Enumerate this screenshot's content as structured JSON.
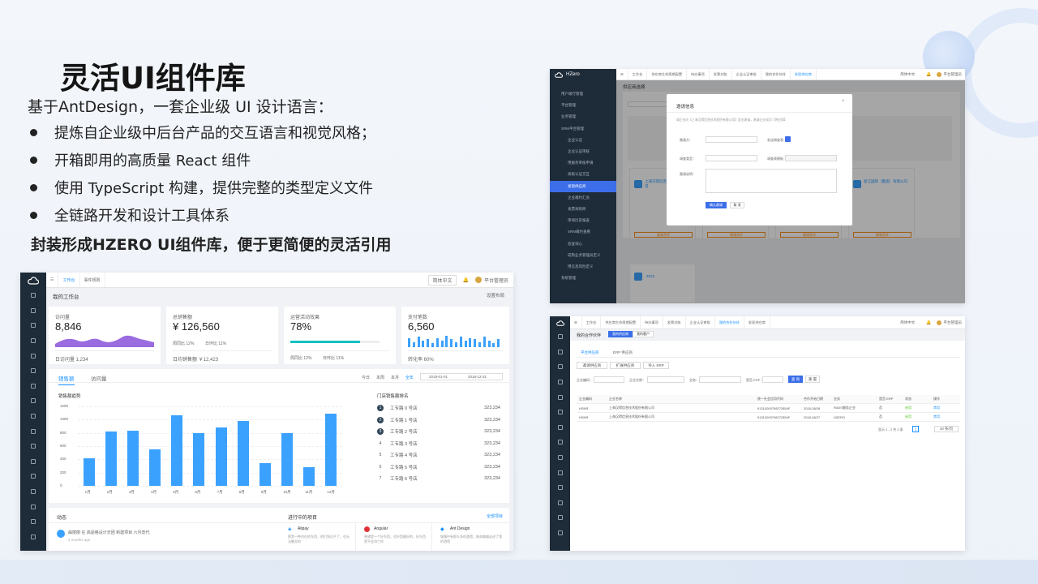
{
  "slide": {
    "title": "灵活UI组件库",
    "intro": "基于AntDesign，一套企业级 UI 设计语言：",
    "bullets": [
      "提炼自企业级中后台产品的交互语言和视觉风格；",
      "开箱即用的高质量 React 组件",
      "使用 TypeScript 构建，提供完整的类型定义文件",
      "全链路开发和设计工具体系"
    ],
    "highlight": "封装形成HZERO UI组件库，便于更简便的灵活引用"
  },
  "dashboard": {
    "tabs": [
      "工作台",
      "事件规则"
    ],
    "lang": "简体中文",
    "user": "平台管理员",
    "page_title": "我的工作台",
    "settings": "设置布局",
    "stats": [
      {
        "label": "访问量",
        "value": "8,846",
        "foot": "日访问量 1,234"
      },
      {
        "label": "总销售额",
        "value": "¥ 126,560",
        "foot1": "周同比 12%",
        "foot2": "日环比 11%",
        "foot3": "日均销售额 ￥12,423"
      },
      {
        "label": "运营活动效果",
        "value": "78%",
        "progress": 0.78,
        "foot1": "周同比 12%",
        "foot2": "日环比 11%"
      },
      {
        "label": "支付笔数",
        "value": "6,560",
        "foot": "转化率 60%"
      }
    ],
    "chart_tabs": [
      "销售额",
      "访问量"
    ],
    "range_tabs": [
      "今日",
      "本周",
      "本月",
      "全年"
    ],
    "date_from": "2018-01-01",
    "date_to": "2018-12-31",
    "chart_title": "销售额趋势",
    "rank_title": "门店销售额排名",
    "chart_data": {
      "type": "bar",
      "title": "销售额趋势",
      "categories": [
        "1月",
        "2月",
        "3月",
        "4月",
        "5月",
        "6月",
        "7月",
        "8月",
        "9月",
        "10月",
        "11月",
        "12月"
      ],
      "values": [
        420,
        820,
        830,
        550,
        1060,
        800,
        880,
        980,
        340,
        800,
        280,
        1090
      ],
      "yticks": [
        "1200",
        "1000",
        "800",
        "600",
        "400",
        "200",
        "0"
      ],
      "ylim": [
        0,
        1200
      ]
    },
    "ranking": [
      {
        "rank": "1",
        "name": "工专路 0 号店",
        "value": "323,234"
      },
      {
        "rank": "2",
        "name": "工专路 1 号店",
        "value": "323,234"
      },
      {
        "rank": "3",
        "name": "工专路 2 号店",
        "value": "323,234"
      },
      {
        "rank": "4",
        "name": "工专路 3 号店",
        "value": "323,234"
      },
      {
        "rank": "5",
        "name": "工专路 4 号店",
        "value": "323,234"
      },
      {
        "rank": "6",
        "name": "工专路 5 号店",
        "value": "323,234"
      },
      {
        "rank": "7",
        "name": "工专路 6 号店",
        "value": "323,234"
      }
    ],
    "activity_title": "动态",
    "activity_text": "曲丽丽 在 高逼格设计天团 新建项目 六月迭代",
    "activity_time": "3 months ago",
    "projects_title": "进行中的项目",
    "projects_all": "全部项目",
    "projects": [
      {
        "name": "Alipay",
        "desc": "那是一种内在的东西，他们到达不了，也无法触及的"
      },
      {
        "name": "Angular",
        "desc": "希望是一个好东西，也许是最好的，好东西是不会消亡的"
      },
      {
        "name": "Ant Design",
        "desc": "城镇中有那么多的酒馆，她却偏偏走进了我的酒馆"
      }
    ]
  },
  "supplier": {
    "logo": "HZero",
    "tabs": [
      "工作台",
      "供应商生命周期配置",
      "待办事项",
      "发票对账",
      "企业认证审批",
      "我的合作伙伴",
      "发现供应商"
    ],
    "lang": "简体中文",
    "user": "平台管理员",
    "page_title": "供应商选择",
    "menu": [
      "用户级行管理",
      "平台管理",
      "业务管理",
      "SRM平台管理",
      "企业认证",
      "企业认证审核",
      "用服务审核申请",
      "高级认证交互",
      "发现供应商",
      "企业邀约汇总",
      "发票采购商",
      "审阅历史报查",
      "SRM邀约查看",
      "答查询心",
      "成熟业务管理员定义",
      "用信息风险定义",
      "系统管理"
    ],
    "active_menu": "发现供应商",
    "modal": {
      "title": "邀请信息",
      "subtitle": "请正在向【上海汉得信息技术股份有限公司】发出邀请，邀请企业成功【供应商】",
      "labels": [
        "邀请方：",
        "发送调查表：",
        "调查类型：",
        "调查表模板：",
        "邀请说明："
      ],
      "ok": "确认邀请",
      "cancel": "取 消"
    },
    "cards": [
      "上海汉得信息技术股份有限公司",
      "浙江国际（集团）有限公司",
      "3213"
    ],
    "card_action": "邀请合作"
  },
  "partners": {
    "tabs": [
      "工作台",
      "供应商生命周期配置",
      "待办事项",
      "发票对账",
      "企业认证审批",
      "我的合作伙伴",
      "发现供应商"
    ],
    "lang": "简体中文",
    "user": "平台管理员",
    "page_title": "我的合作伙伴",
    "seg": [
      "我的供应商",
      "我的客户"
    ],
    "sub_tabs": [
      "平台供应商",
      "ERP 供应商"
    ],
    "actions": [
      "邀请供应商",
      "扩展供应商",
      "导入 ERP"
    ],
    "filters": [
      "企业编码：",
      "企业名称：",
      "业务：",
      "是否 ERP："
    ],
    "search": "查 询",
    "reset": "重 置",
    "columns": [
      "企业编码",
      "企业名称",
      "统一社会信用代码",
      "合作开始日期",
      "业务",
      "是否 ERP",
      "状态",
      "操作"
    ],
    "rows": [
      [
        "HSNR",
        "上海汉得信息技术股份有限公司",
        "91310000798272854F",
        "2018-08/28",
        "RASS服务企业",
        "否",
        "启用",
        "禁用"
      ],
      [
        "HSNR",
        "上海汉得信息技术股份有限公司",
        "91310000798272854F",
        "2018-08/27",
        "HZERO",
        "否",
        "启用",
        "禁用"
      ]
    ],
    "pagination": "显示 1 - 2 共 2 条",
    "page": "1",
    "page_size": "10 条/页"
  }
}
